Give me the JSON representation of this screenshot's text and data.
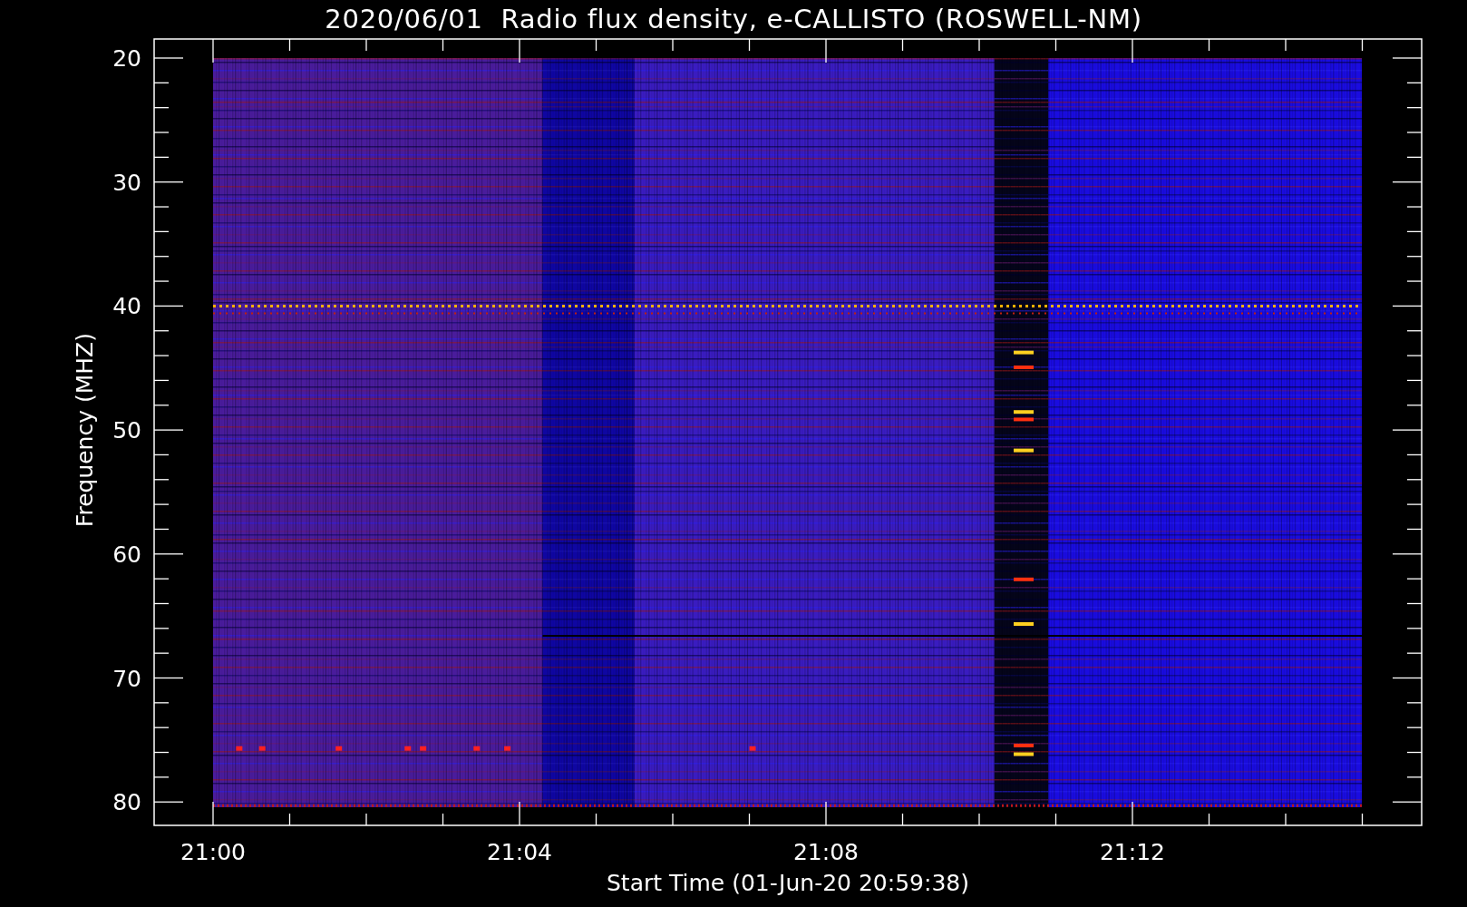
{
  "title": "2020/06/01  Radio flux density, e-CALLISTO (ROSWELL-NM)",
  "plot": {
    "ylabel": "Frequency (MHZ)",
    "xlabel": "Start Time (01-Jun-20 20:59:38)",
    "yticks": [
      "20",
      "30",
      "40",
      "50",
      "60",
      "70",
      "80"
    ],
    "xticks": [
      "21:00",
      "21:04",
      "21:08",
      "21:12"
    ]
  }
}
